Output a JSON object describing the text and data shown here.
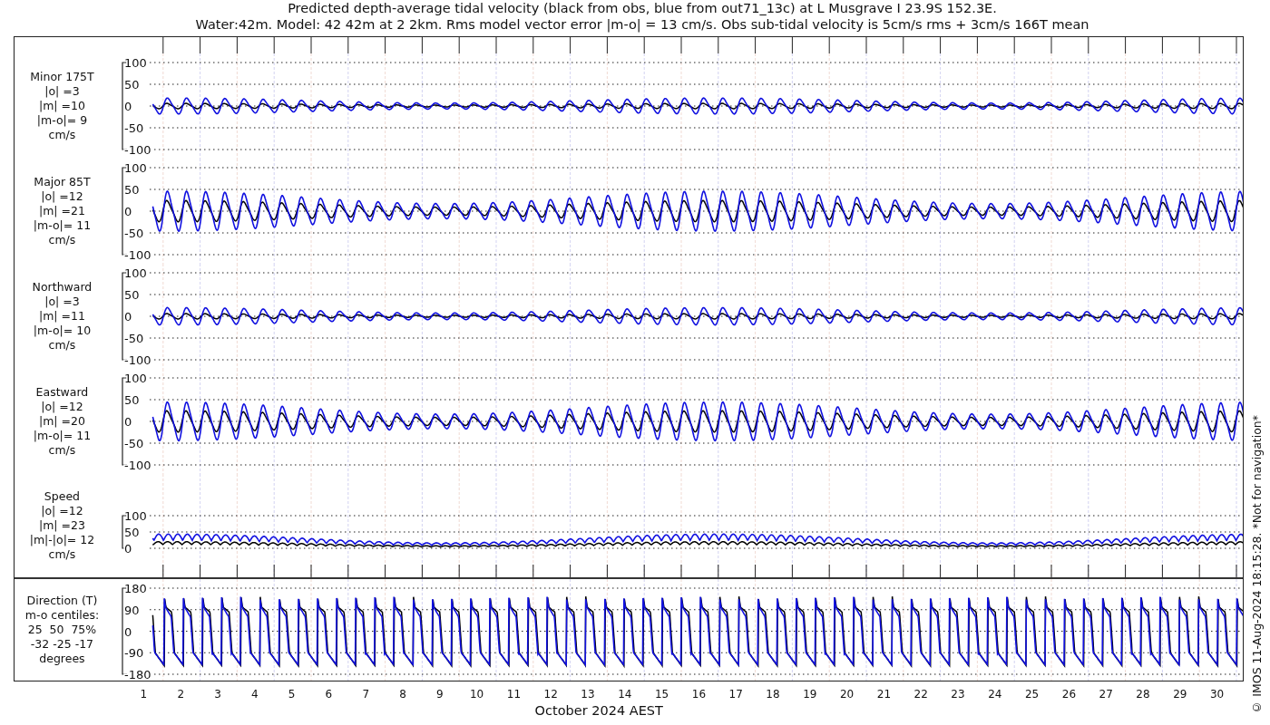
{
  "title_lines": [
    "Predicted depth-average tidal velocity (black from obs, blue from out71_13c) at L Musgrave I 23.9S 152.3E.",
    "Water:42m. Model: 42 42m at 2 2km. Rms model vector error |m-o| = 13 cm/s. Obs sub-tidal velocity is 5cm/s rms + 3cm/s 166T mean"
  ],
  "panels": [
    {
      "kind": "signed",
      "label_lines": [
        "Minor 175T",
        "|o| =3",
        "|m| =10",
        "|m-o|= 9",
        "cm/s"
      ],
      "yticks": [
        "100",
        "50",
        "0",
        "-50",
        "-100"
      ]
    },
    {
      "kind": "signed",
      "label_lines": [
        "Major 85T",
        "|o| =12",
        "|m| =21",
        "|m-o|= 11",
        "cm/s"
      ],
      "yticks": [
        "100",
        "50",
        "0",
        "-50",
        "-100"
      ]
    },
    {
      "kind": "signed",
      "label_lines": [
        "Northward",
        "|o| =3",
        "|m| =11",
        "|m-o|= 10",
        "cm/s"
      ],
      "yticks": [
        "100",
        "50",
        "0",
        "-50",
        "-100"
      ]
    },
    {
      "kind": "signed",
      "label_lines": [
        "Eastward",
        "|o| =12",
        "|m| =20",
        "|m-o|= 11",
        "cm/s"
      ],
      "yticks": [
        "100",
        "50",
        "0",
        "-50",
        "-100"
      ]
    },
    {
      "kind": "speed",
      "label_lines": [
        "Speed",
        "|o| =12",
        "|m| =23",
        "|m|-|o|= 12",
        "cm/s"
      ],
      "yticks": [
        "100",
        "50",
        "0"
      ]
    },
    {
      "kind": "direction",
      "label_lines": [
        "Direction (T)",
        "m-o centiles:",
        "25  50  75%",
        "-32 -25 -17",
        "degrees"
      ],
      "yticks": [
        "180",
        "90",
        "0",
        "-90",
        "-180"
      ]
    }
  ],
  "x_axis": {
    "days": [
      "1",
      "2",
      "3",
      "4",
      "5",
      "6",
      "7",
      "8",
      "9",
      "10",
      "11",
      "12",
      "13",
      "14",
      "15",
      "16",
      "17",
      "18",
      "19",
      "20",
      "21",
      "22",
      "23",
      "24",
      "25",
      "26",
      "27",
      "28",
      "29",
      "30"
    ],
    "label": "October 2024 AEST"
  },
  "footer_note": "© IMOS 11-Aug-2024 18:15:28. *Not for navigation*"
}
